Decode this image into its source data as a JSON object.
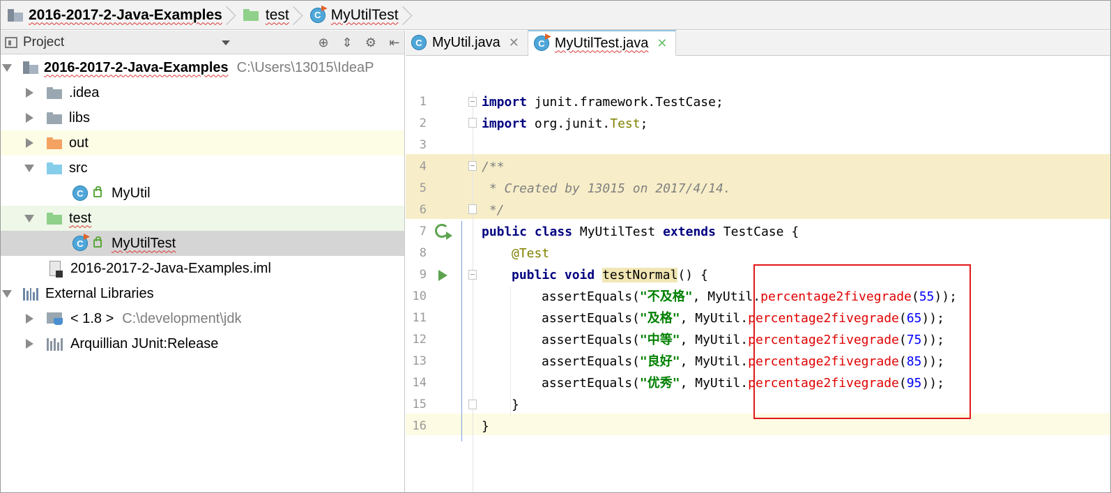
{
  "breadcrumb": {
    "project": "2016-2017-2-Java-Examples",
    "folder": "test",
    "file": "MyUtilTest"
  },
  "project_panel": {
    "title": "Project",
    "tree": [
      {
        "label": "2016-2017-2-Java-Examples",
        "path": "C:\\Users\\13015\\IdeaP"
      },
      {
        "label": ".idea"
      },
      {
        "label": "libs"
      },
      {
        "label": "out"
      },
      {
        "label": "src"
      },
      {
        "label": "MyUtil"
      },
      {
        "label": "test"
      },
      {
        "label": "MyUtilTest"
      },
      {
        "label": "2016-2017-2-Java-Examples.iml"
      },
      {
        "label": "External Libraries"
      },
      {
        "label": "< 1.8 >",
        "path": "C:\\development\\jdk"
      },
      {
        "label": "Arquillian JUnit:Release"
      }
    ]
  },
  "editor": {
    "tabs": [
      {
        "label": "MyUtil.java"
      },
      {
        "label": "MyUtilTest.java"
      }
    ],
    "line_numbers": [
      "1",
      "2",
      "3",
      "4",
      "5",
      "6",
      "7",
      "8",
      "9",
      "10",
      "11",
      "12",
      "13",
      "14",
      "15",
      "16"
    ],
    "code": {
      "l1_kw": "import",
      "l1_rest": " junit.framework.TestCase;",
      "l2_kw": "import",
      "l2_rest": " org.junit.",
      "l2_ann": "Test",
      "l2_end": ";",
      "l4": "/**",
      "l5": " * Created by 13015 on 2017/4/14.",
      "l6": " */",
      "l7_kw1": "public class",
      "l7_name": " MyUtilTest ",
      "l7_kw2": "extends",
      "l7_rest": " TestCase {",
      "l8": "@Test",
      "l9_kw": "public void",
      "l9_meth": "testNormal",
      "l9_rest": "() {",
      "asserts": [
        {
          "call": "assertEquals(",
          "str": "\"不及格\"",
          "mid": ", MyUtil.",
          "meth": "percentage2fivegrade",
          "open": "(",
          "num": "55",
          "close": "));"
        },
        {
          "call": "assertEquals(",
          "str": "\"及格\"",
          "mid": ", MyUtil.",
          "meth": "percentage2fivegrade",
          "open": "(",
          "num": "65",
          "close": "));"
        },
        {
          "call": "assertEquals(",
          "str": "\"中等\"",
          "mid": ", MyUtil.",
          "meth": "percentage2fivegrade",
          "open": "(",
          "num": "75",
          "close": "));"
        },
        {
          "call": "assertEquals(",
          "str": "\"良好\"",
          "mid": ", MyUtil.",
          "meth": "percentage2fivegrade",
          "open": "(",
          "num": "85",
          "close": "));"
        },
        {
          "call": "assertEquals(",
          "str": "\"优秀\"",
          "mid": ", MyUtil.",
          "meth": "percentage2fivegrade",
          "open": "(",
          "num": "95",
          "close": "));"
        }
      ],
      "l15": "}",
      "l16": "}"
    }
  },
  "colors": {
    "keyword": "#000080",
    "string": "#008000",
    "number": "#0000ff",
    "static_method": "#e00000",
    "annotation_box": "#e01818"
  }
}
